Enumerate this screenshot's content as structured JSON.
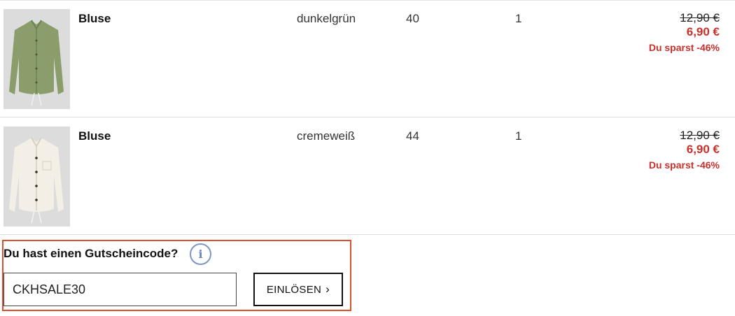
{
  "cart": {
    "items": [
      {
        "name": "Bluse",
        "color": "dunkelgrün",
        "size": "40",
        "quantity": "1",
        "old_price": "12,90 €",
        "new_price": "6,90 €",
        "saving": "Du sparst -46%",
        "image": "blouse-green-icon",
        "image_color": "#8a9d6a"
      },
      {
        "name": "Bluse",
        "color": "cremeweiß",
        "size": "44",
        "quantity": "1",
        "old_price": "12,90 €",
        "new_price": "6,90 €",
        "saving": "Du sparst -46%",
        "image": "blouse-cream-icon",
        "image_color": "#f3efe6"
      }
    ]
  },
  "voucher": {
    "title": "Du hast einen Gutscheincode?",
    "info_icon": "info-icon",
    "info_glyph": "i",
    "input_value": "CKHSALE30",
    "button_label": "EINLÖSEN",
    "button_chevron": "›"
  },
  "colors": {
    "sale_red": "#c8302a",
    "highlight_border": "#d9502f",
    "info_blue": "#7d97c4"
  }
}
